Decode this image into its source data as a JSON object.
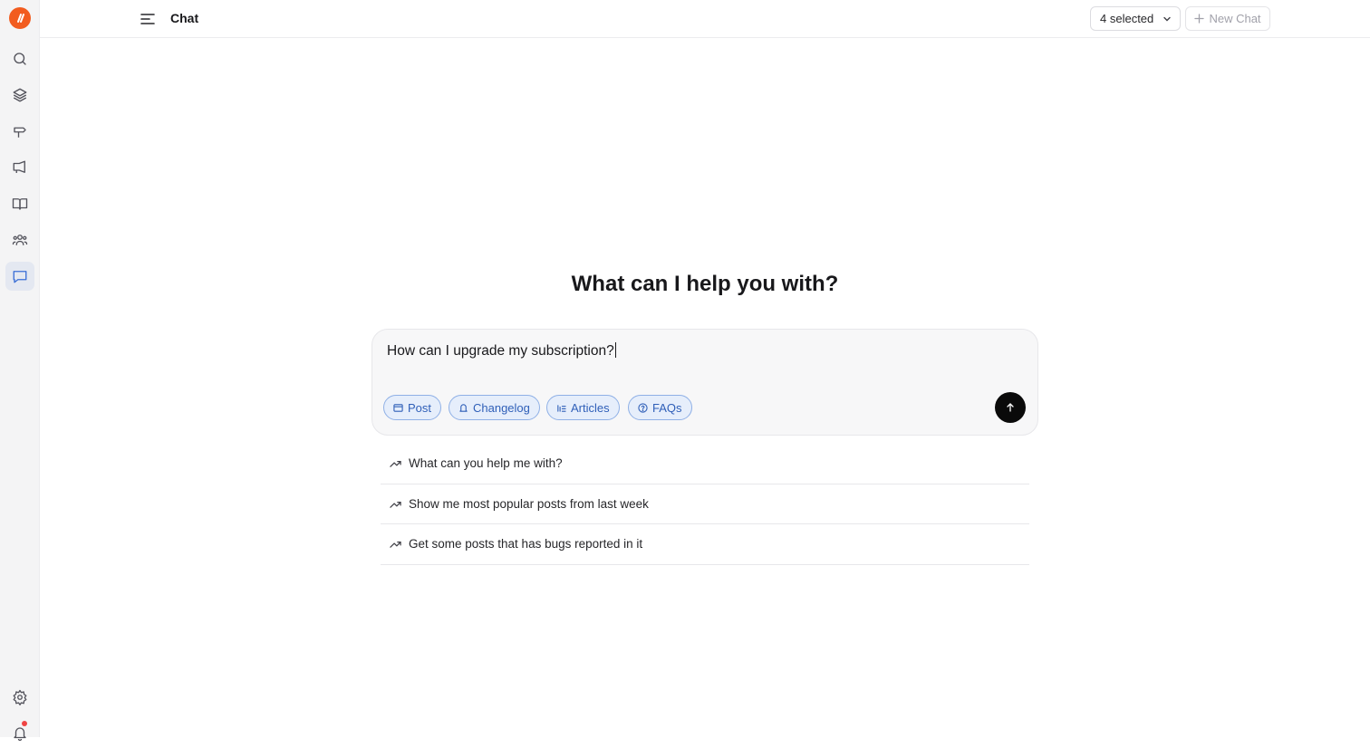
{
  "app": {
    "brand_color": "#f25c1f",
    "accent": "#3b6fd6"
  },
  "rail": {
    "items": [
      {
        "name": "search-icon"
      },
      {
        "name": "layers-icon"
      },
      {
        "name": "signpost-icon"
      },
      {
        "name": "megaphone-icon"
      },
      {
        "name": "book-icon"
      },
      {
        "name": "users-icon"
      },
      {
        "name": "chat-icon",
        "active": true
      }
    ],
    "bottom": [
      {
        "name": "settings-icon"
      },
      {
        "name": "bell-icon",
        "has_notification": true
      }
    ]
  },
  "topbar": {
    "title": "Chat",
    "selector_label": "4 selected",
    "new_chat_label": "New Chat"
  },
  "main": {
    "heading": "What can I help you with?",
    "composer": {
      "value": "How can I upgrade my subscription?",
      "chips": [
        "Post",
        "Changelog",
        "Articles",
        "FAQs"
      ]
    },
    "suggestions": [
      "What can you help me with?",
      "Show me most popular posts from last week",
      "Get some posts that has bugs reported in it"
    ]
  }
}
